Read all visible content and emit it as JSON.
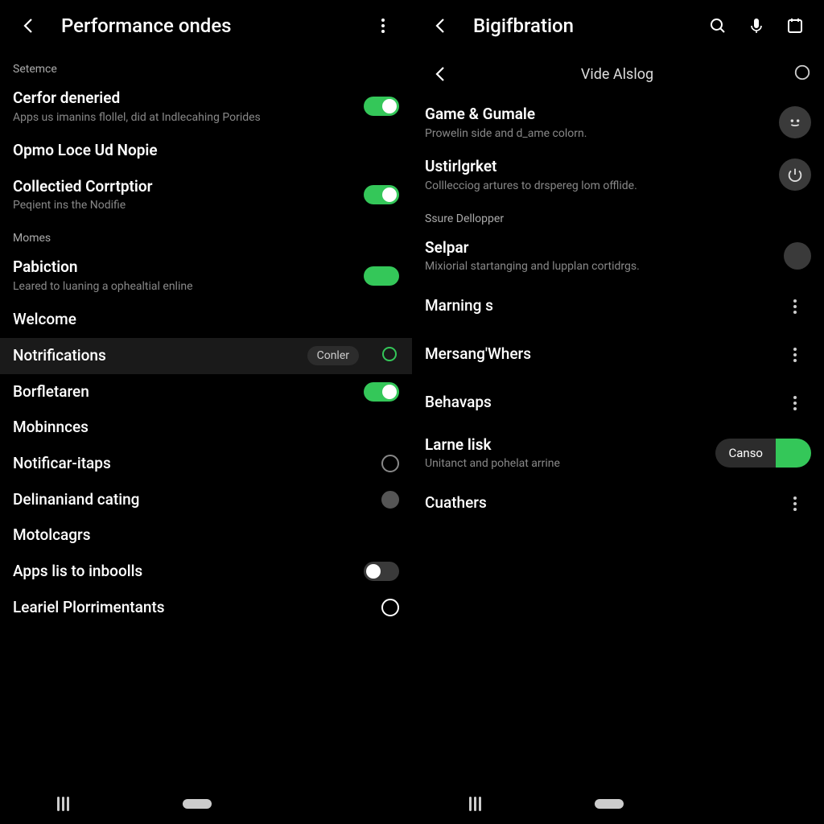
{
  "left": {
    "title": "Performance ondes",
    "sections": [
      {
        "header": "Setemce",
        "items": [
          {
            "id": "cerfor",
            "title": "Cerfor deneried",
            "sub": "Apps us imanins flollel, did at Indlecahing Porides",
            "control": "toggle-on"
          },
          {
            "id": "opmo-1",
            "title": "Opmo Loce Ud Nopie",
            "control": "none"
          },
          {
            "id": "collected",
            "title": "Collectied Corrtptior",
            "sub": "Peqient ins the Nodifie",
            "control": "toggle-on"
          }
        ]
      },
      {
        "header": "Momes",
        "items": [
          {
            "id": "pabiction",
            "title": "Pabiction",
            "sub": "Leared to luaning a ophealtial enline",
            "control": "toggle-on-noknob"
          },
          {
            "id": "welcome",
            "title": "Welcome",
            "control": "none"
          },
          {
            "id": "notifications",
            "title": "Notrifications",
            "control": "pill-outline",
            "pill": "Conler",
            "selected": true
          },
          {
            "id": "borfletaren",
            "title": "Borfletaren",
            "control": "toggle-on"
          },
          {
            "id": "mobinnces",
            "title": "Mobinnces",
            "control": "none"
          },
          {
            "id": "notificar-itaps",
            "title": "Notificar-itaps",
            "control": "radio"
          },
          {
            "id": "delinand",
            "title": "Delinaniand cating",
            "control": "radio-filled"
          },
          {
            "id": "motolcagrs",
            "title": "Motolcagrs",
            "control": "none"
          },
          {
            "id": "apps-lis",
            "title": "Apps lis to inboolls",
            "control": "toggle-off"
          },
          {
            "id": "leariei",
            "title": "Leariel Plorrimentants",
            "control": "radio"
          }
        ]
      }
    ]
  },
  "right": {
    "title": "Bigifbration",
    "subbar_title": "Vide Alslog",
    "groups": [
      {
        "header": null,
        "items": [
          {
            "id": "game-gumale",
            "title": "Game & Gumale",
            "sub": "Prowelin side and d_ame colorn.",
            "trailing": "face"
          },
          {
            "id": "ustirgrket",
            "title": "Ustirlgrket",
            "sub": "Colllecciog artures to drspereg lom offlide.",
            "trailing": "power"
          }
        ]
      },
      {
        "header": "Ssure Dellopper",
        "items": [
          {
            "id": "selpar",
            "title": "Selpar",
            "sub": "Mixiorial startanging and lupplan cortidrgs.",
            "trailing": "dot"
          },
          {
            "id": "marning",
            "title": "Marning s",
            "trailing": "kebab"
          },
          {
            "id": "mersang",
            "title": "Mersang'Whers",
            "trailing": "kebab"
          },
          {
            "id": "behavaps",
            "title": "Behavaps",
            "trailing": "kebab"
          },
          {
            "id": "larne",
            "title": "Larne lisk",
            "sub": "Unitanct and pohelat arrine",
            "trailing": "pill-split",
            "pill": "Canso"
          },
          {
            "id": "cuathers",
            "title": "Cuathers",
            "trailing": "kebab"
          }
        ]
      }
    ]
  }
}
